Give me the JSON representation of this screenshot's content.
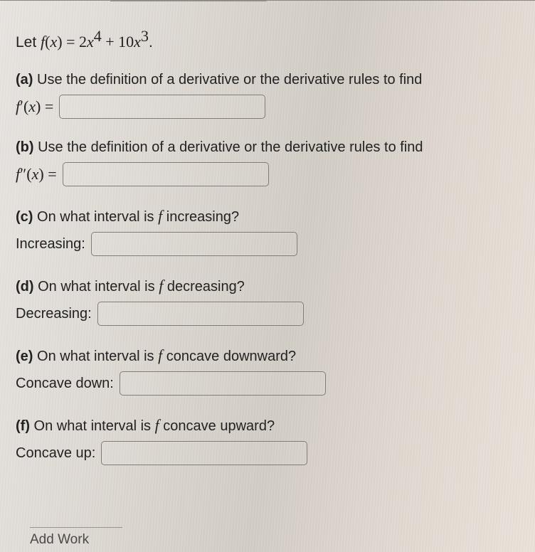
{
  "lead": {
    "prefix": "Let ",
    "func_html": "f(x) = 2x^4 + 10x^3",
    "suffix": "."
  },
  "parts": {
    "a": {
      "tag": "(a)",
      "text": "Use the definition of a derivative or the derivative rules to find",
      "label_math": "f'(x) =",
      "value": ""
    },
    "b": {
      "tag": "(b)",
      "text": "Use the definition of a derivative or the derivative rules to find",
      "label_math": "f''(x) =",
      "value": ""
    },
    "c": {
      "tag": "(c)",
      "text_before": "On what interval is ",
      "text_after": " increasing?",
      "label": "Increasing:",
      "value": ""
    },
    "d": {
      "tag": "(d)",
      "text_before": "On what interval is ",
      "text_after": " decreasing?",
      "label": "Decreasing:",
      "value": ""
    },
    "e": {
      "tag": "(e)",
      "text_before": "On what interval is ",
      "text_after": " concave downward?",
      "label": "Concave down:",
      "value": ""
    },
    "f": {
      "tag": "(f)",
      "text_before": "On what interval is ",
      "text_after": " concave upward?",
      "label": "Concave up:",
      "value": ""
    }
  },
  "footer": {
    "add_work": "Add Work"
  }
}
